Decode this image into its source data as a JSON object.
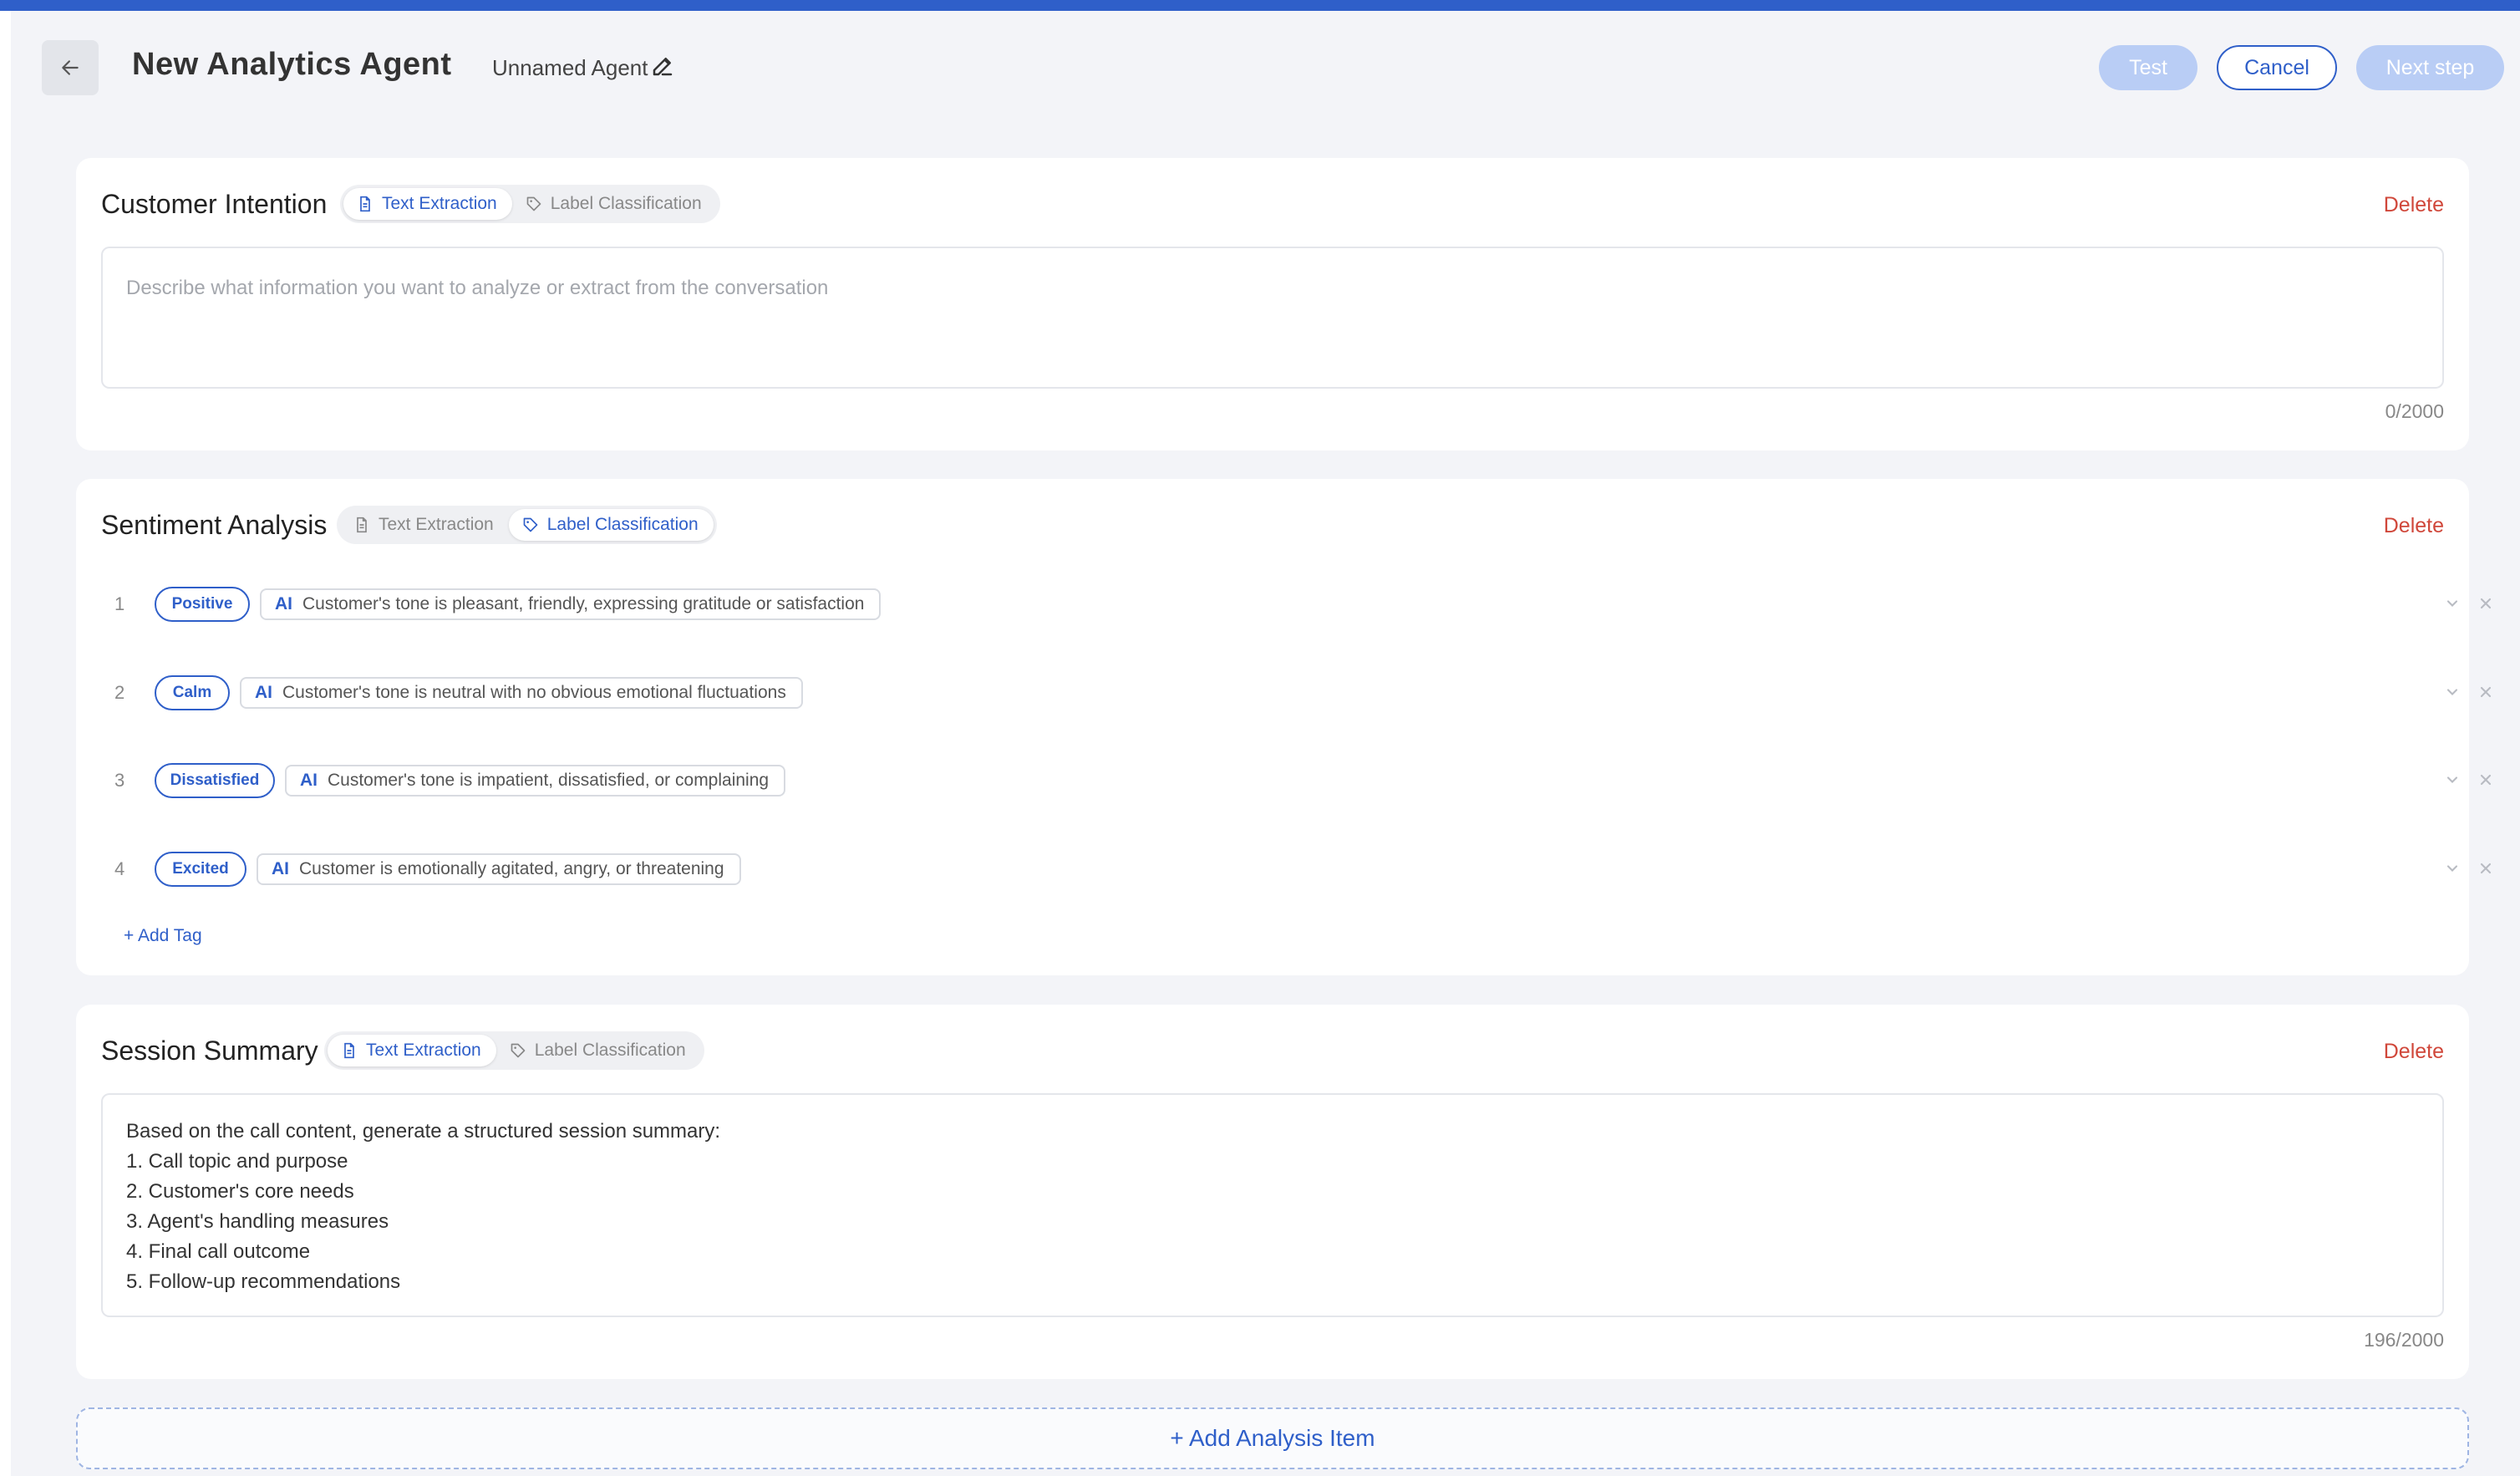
{
  "header": {
    "title": "New Analytics Agent",
    "agent_name": "Unnamed Agent",
    "buttons": {
      "test": "Test",
      "cancel": "Cancel",
      "next": "Next step"
    }
  },
  "modes": {
    "text_extraction": "Text Extraction",
    "label_classification": "Label Classification"
  },
  "delete_label": "Delete",
  "cards": {
    "customer_intention": {
      "title": "Customer Intention",
      "active_mode": "text_extraction",
      "placeholder": "Describe what information you want to analyze or extract from the conversation",
      "counter": "0/2000"
    },
    "sentiment_analysis": {
      "title": "Sentiment Analysis",
      "active_mode": "label_classification",
      "ai_badge": "AI",
      "tags": [
        {
          "num": "1",
          "label": "Positive",
          "description": "Customer's tone is pleasant, friendly, expressing gratitude or satisfaction"
        },
        {
          "num": "2",
          "label": "Calm",
          "description": "Customer's tone is neutral with no obvious emotional fluctuations"
        },
        {
          "num": "3",
          "label": "Dissatisfied",
          "description": "Customer's tone is impatient, dissatisfied, or complaining"
        },
        {
          "num": "4",
          "label": "Excited",
          "description": "Customer is emotionally agitated, angry, or threatening"
        }
      ],
      "add_tag": "+ Add Tag"
    },
    "session_summary": {
      "title": "Session Summary",
      "active_mode": "text_extraction",
      "content_lines": [
        "Based on the call content, generate a structured session summary:",
        "1. Call topic and purpose",
        "2. Customer's core needs",
        "3. Agent's handling measures",
        "4. Final call outcome",
        "5. Follow-up recommendations"
      ],
      "counter": "196/2000"
    }
  },
  "add_item": "+ Add Analysis Item",
  "colors": {
    "accent": "#2f5fc9",
    "danger": "#d0473a",
    "disabled": "#b9cdf5",
    "page_bg": "#f3f4f8"
  },
  "icons": {
    "back": "arrow-left-icon",
    "edit": "pencil-icon",
    "text_mode": "document-icon",
    "label_mode": "tag-icon",
    "row_expand": "chevron-down-icon",
    "row_remove": "close-icon"
  }
}
